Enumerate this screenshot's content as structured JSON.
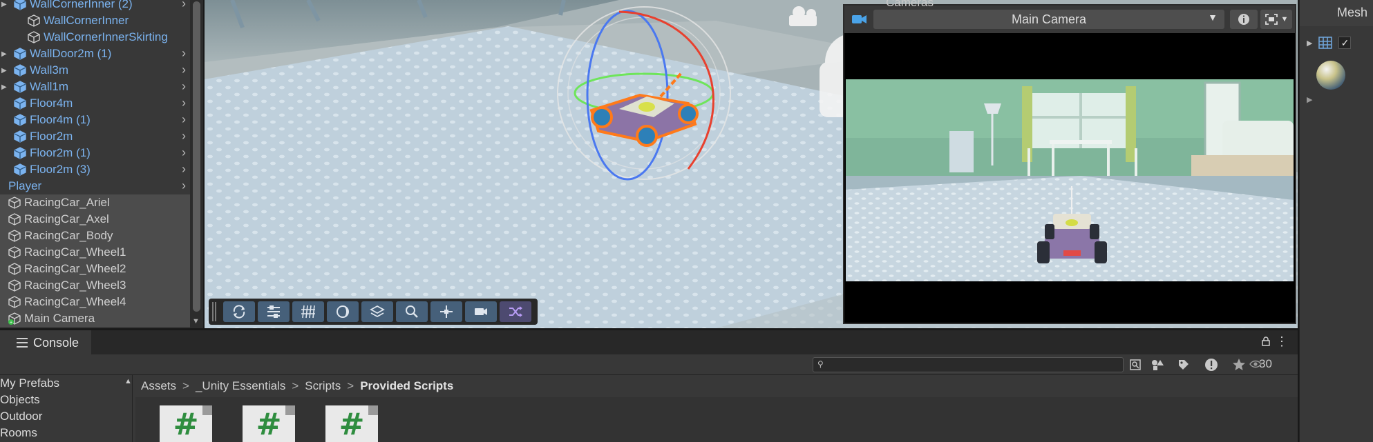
{
  "hierarchy": {
    "items": [
      {
        "label": "WallCornerInner (2)",
        "type": "prefab",
        "indent": 1,
        "expandable": true
      },
      {
        "label": "WallCornerInner",
        "type": "prefab-child",
        "indent": 2,
        "expandable": false
      },
      {
        "label": "WallCornerInnerSkirting",
        "type": "prefab-child",
        "indent": 2,
        "expandable": false
      },
      {
        "label": "WallDoor2m (1)",
        "type": "prefab",
        "indent": 1,
        "expandable": true
      },
      {
        "label": "Wall3m",
        "type": "prefab",
        "indent": 1,
        "expandable": true
      },
      {
        "label": "Wall1m",
        "type": "prefab",
        "indent": 1,
        "expandable": true
      },
      {
        "label": "Floor4m",
        "type": "prefab",
        "indent": 1,
        "expandable": false
      },
      {
        "label": "Floor4m (1)",
        "type": "prefab",
        "indent": 1,
        "expandable": false
      },
      {
        "label": "Floor2m",
        "type": "prefab",
        "indent": 1,
        "expandable": false
      },
      {
        "label": "Floor2m (1)",
        "type": "prefab",
        "indent": 1,
        "expandable": false
      },
      {
        "label": "Floor2m (3)",
        "type": "prefab",
        "indent": 1,
        "expandable": false
      },
      {
        "label": "Player",
        "type": "prefab-root",
        "indent": 0,
        "expandable": false
      },
      {
        "label": "RacingCar_Ariel",
        "type": "object",
        "indent": 0,
        "expandable": false
      },
      {
        "label": "RacingCar_Axel",
        "type": "object",
        "indent": 0,
        "expandable": false
      },
      {
        "label": "RacingCar_Body",
        "type": "object",
        "indent": 0,
        "expandable": false
      },
      {
        "label": "RacingCar_Wheel1",
        "type": "object",
        "indent": 0,
        "expandable": false
      },
      {
        "label": "RacingCar_Wheel2",
        "type": "object",
        "indent": 0,
        "expandable": false
      },
      {
        "label": "RacingCar_Wheel3",
        "type": "object",
        "indent": 0,
        "expandable": false
      },
      {
        "label": "RacingCar_Wheel4",
        "type": "object",
        "indent": 0,
        "expandable": false
      },
      {
        "label": "Main Camera",
        "type": "camera",
        "indent": 0,
        "expandable": false
      }
    ]
  },
  "scene": {
    "toolbar": {
      "buttons": [
        "orbit-icon",
        "sliders-icon",
        "grid-icon",
        "shading-icon",
        "layers-icon",
        "search-icon",
        "move-icon",
        "camera-icon",
        "shuffle-icon"
      ]
    }
  },
  "camera_preview": {
    "panel_title": "Cameras",
    "selected_camera": "Main Camera"
  },
  "inspector": {
    "mesh_label": "Mesh"
  },
  "console": {
    "tab_label": "Console"
  },
  "project": {
    "search_placeholder": "",
    "hidden_count": "30",
    "tree": [
      "My Prefabs",
      "Objects",
      "Outdoor",
      "Rooms"
    ],
    "breadcrumb": [
      "Assets",
      "_Unity Essentials",
      "Scripts",
      "Provided Scripts"
    ],
    "files": [
      {
        "icon": "csharp-script-icon",
        "glyph": "#"
      },
      {
        "icon": "csharp-script-icon",
        "glyph": "#"
      },
      {
        "icon": "csharp-script-icon",
        "glyph": "#"
      }
    ]
  },
  "colors": {
    "prefab_text": "#7bb3ef",
    "panel_bg": "#383838",
    "toolbar_button": "#46607a",
    "selection_orange": "#ff7a1a"
  }
}
